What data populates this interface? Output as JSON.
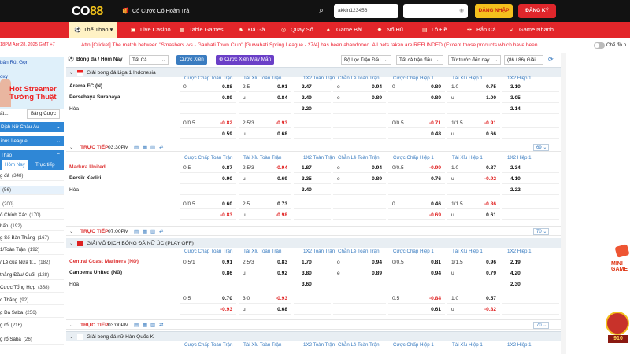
{
  "header": {
    "logo_main": "CO",
    "logo_accent": "88",
    "promo_text": "Có Cược Có Hoàn Trả",
    "username_value": "akkin123456",
    "password_value": "",
    "login_label": "ĐĂNG NHẬP",
    "register_label": "ĐĂNG KÝ"
  },
  "nav": {
    "items": [
      {
        "label": "Thể Thao",
        "icon": "soccer-ball-icon"
      },
      {
        "label": "Live Casino",
        "icon": "cards-icon"
      },
      {
        "label": "Table Games",
        "icon": "table-icon"
      },
      {
        "label": "Đá Gà",
        "icon": "rooster-icon"
      },
      {
        "label": "Quay Số",
        "icon": "lottery-icon"
      },
      {
        "label": "Game Bài",
        "icon": "card-game-icon"
      },
      {
        "label": "Nổ Hũ",
        "icon": "slot-icon"
      },
      {
        "label": "Lô Đề",
        "icon": "lotto-icon"
      },
      {
        "label": "Bắn Cá",
        "icon": "fish-icon"
      },
      {
        "label": "Game Nhanh",
        "icon": "rocket-icon"
      }
    ]
  },
  "ticker": {
    "time": "18PM Apr 28, 2025 GMT +7",
    "text": "Attn:[Cricket] The match between \"Smashers -vs - Gauhati Town Club\" [Guwahati Spring League - 27/4] has been abandoned. All bets taken are REFUNDED (Except those products which have been",
    "toggle_label": "Chế độ n"
  },
  "sidebar": {
    "banner_line1": "bản Rút Gọn",
    "banner_line2": "oxy",
    "banner_big1": "Hot Streamer",
    "banner_big2": "Tường Thuật",
    "tab_left": "ất...",
    "tab_button": "Bảng Cược",
    "rows_blue": [
      {
        "label": "Dịch Nữ Châu Âu"
      },
      {
        "label": "ions League"
      },
      {
        "label": "Thao"
      }
    ],
    "tab_today": "Hôm Nay",
    "tab_live": "Trực tiếp",
    "subs": [
      {
        "label": "g đá",
        "count": "(348)"
      },
      {
        "label": "",
        "count": "(56)"
      },
      {
        "label": "",
        "count": "(200)"
      },
      {
        "label": "ố Chính Xác",
        "count": "(170)"
      },
      {
        "label": "hấp",
        "count": "(192)"
      },
      {
        "label": "g Số Bàn Thắng",
        "count": "(167)"
      },
      {
        "label": "1/Toàn Trận",
        "count": "(192)"
      },
      {
        "label": "/ Lẻ của Nửa tr...",
        "count": "(182)"
      },
      {
        "label": "thắng Đầu/ Cuối",
        "count": "(128)"
      },
      {
        "label": "Cược Tổng Hợp",
        "count": "(358)"
      },
      {
        "label": "c Thắng",
        "count": "(92)"
      },
      {
        "label": "g Đá Saba",
        "count": "(256)"
      },
      {
        "label": "g rổ",
        "count": "(216)"
      },
      {
        "label": "g rổ Saba",
        "count": "(26)"
      }
    ]
  },
  "filters": {
    "sport": "Bóng đá / Hôm Nay",
    "select_all": "Tất Cả",
    "parlay": "Cược Xiên",
    "parlay_lucky": "Cược Xiên May Mắn",
    "filter_leagues": "Bộ Lọc Trận Đấu",
    "all_matches": "Tất cả trận đấu",
    "sort_order": "Từ trước đến nay",
    "count": "(86 / 86) Giải"
  },
  "market_headers": [
    "Cược Chấp Toàn Trận",
    "Tài Xỉu Toàn Trận",
    "1X2 Toàn Trận",
    "Chẵn Lẻ Toàn Trận",
    "Cược Chấp Hiệp 1",
    "Tài Xỉu Hiệp 1",
    "1X2 Hiệp 1"
  ],
  "leagues": [
    {
      "name": "Giải bóng đá Liga 1 Indonesia",
      "home": "Arema FC (N)",
      "away": "Persebaya Surabaya",
      "draw": "Hòa",
      "live_label": "TRỰC TIẾP",
      "time": "03:30PM",
      "more": "69"
    },
    {
      "name": "",
      "home": "Madura United",
      "away": "Persik Kediri",
      "draw": "Hòa",
      "live_label": "TRỰC TIẾP",
      "time": "07:00PM",
      "more": "70"
    },
    {
      "name": "GIẢI VÔ ĐỊCH BÓNG ĐÁ NỮ ÚC (PLAY OFF)",
      "home": "Central Coast Mariners (Nữ)",
      "away": "Canberra United (Nữ)",
      "draw": "Hòa",
      "live_label": "TRỰC TIẾP",
      "time": "03:00PM",
      "more": "70"
    },
    {
      "name": "Giải bóng đá nữ Hàn Quốc K"
    }
  ],
  "odds": {
    "m1": [
      [
        "0",
        "0.88",
        "2.5",
        "0.91",
        "2.47",
        "o",
        "0.94",
        "0",
        "0.89",
        "1.0",
        "0.75",
        "3.10"
      ],
      [
        "",
        "0.89",
        "u",
        "0.84",
        "2.49",
        "e",
        "0.89",
        "",
        "0.89",
        "u",
        "1.00",
        "3.05"
      ],
      [
        "",
        "",
        "",
        "",
        "3.20",
        "",
        "",
        "",
        "",
        "",
        "",
        "2.14"
      ],
      [
        "0/0.5",
        "-0.82",
        "2.5/3",
        "-0.93",
        "",
        "",
        "",
        "0/0.5",
        "-0.71",
        "1/1.5",
        "-0.91",
        ""
      ],
      [
        "",
        "0.59",
        "u",
        "0.68",
        "",
        "",
        "",
        "",
        "0.48",
        "u",
        "0.66",
        ""
      ]
    ],
    "m2": [
      [
        "0.5",
        "0.87",
        "2.5/3",
        "-0.94",
        "1.87",
        "o",
        "0.94",
        "0/0.5",
        "-0.99",
        "1.0",
        "0.87",
        "2.34"
      ],
      [
        "",
        "0.90",
        "u",
        "0.69",
        "3.35",
        "e",
        "0.89",
        "",
        "0.76",
        "u",
        "-0.92",
        "4.10"
      ],
      [
        "",
        "",
        "",
        "",
        "3.40",
        "",
        "",
        "",
        "",
        "",
        "",
        "2.22"
      ],
      [
        "0/0.5",
        "0.60",
        "2.5",
        "0.73",
        "",
        "",
        "",
        "0",
        "0.46",
        "1/1.5",
        "-0.86",
        ""
      ],
      [
        "",
        "-0.83",
        "u",
        "-0.98",
        "",
        "",
        "",
        "",
        "-0.69",
        "u",
        "0.61",
        ""
      ]
    ],
    "m3": [
      [
        "0.5/1",
        "0.91",
        "2.5/3",
        "0.83",
        "1.70",
        "o",
        "0.94",
        "0/0.5",
        "0.81",
        "1/1.5",
        "0.96",
        "2.19"
      ],
      [
        "",
        "0.86",
        "u",
        "0.92",
        "3.80",
        "e",
        "0.89",
        "",
        "0.94",
        "u",
        "0.79",
        "4.20"
      ],
      [
        "",
        "",
        "",
        "",
        "3.60",
        "",
        "",
        "",
        "",
        "",
        "",
        "2.30"
      ],
      [
        "0.5",
        "0.70",
        "3.0",
        "-0.93",
        "",
        "",
        "",
        "0.5",
        "-0.84",
        "1.0",
        "0.57",
        ""
      ],
      [
        "",
        "-0.93",
        "u",
        "0.68",
        "",
        "",
        "",
        "",
        "0.61",
        "u",
        "-0.82",
        ""
      ]
    ]
  },
  "colors": {
    "header_bg": "#121212",
    "nav_red": "#e3262a",
    "accent_blue": "#3a7cc0",
    "negative": "#e02020",
    "login_yellow": "#f4c01d"
  }
}
